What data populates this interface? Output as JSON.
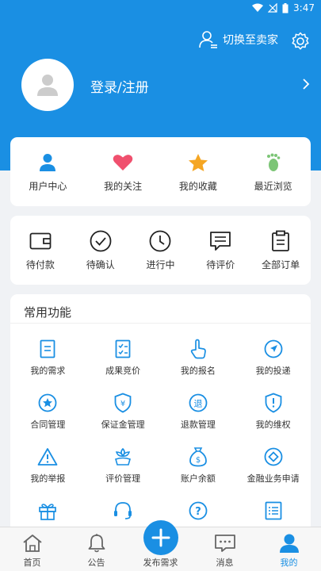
{
  "status_bar": {
    "time": "3:47"
  },
  "header": {
    "switch_label": "切换至卖家"
  },
  "profile": {
    "login_label": "登录/注册"
  },
  "quick_links": [
    {
      "label": "用户中心",
      "icon": "user-icon"
    },
    {
      "label": "我的关注",
      "icon": "heart-icon"
    },
    {
      "label": "我的收藏",
      "icon": "star-icon"
    },
    {
      "label": "最近浏览",
      "icon": "footprint-icon"
    }
  ],
  "orders": [
    {
      "label": "待付款",
      "icon": "wallet-icon"
    },
    {
      "label": "待确认",
      "icon": "check-circle-icon"
    },
    {
      "label": "进行中",
      "icon": "clock-icon"
    },
    {
      "label": "待评价",
      "icon": "comment-icon"
    },
    {
      "label": "全部订单",
      "icon": "clipboard-icon"
    }
  ],
  "functions": {
    "title": "常用功能",
    "items": [
      {
        "label": "我的需求",
        "icon": "document-icon"
      },
      {
        "label": "成果竞价",
        "icon": "checklist-icon"
      },
      {
        "label": "我的报名",
        "icon": "hand-pointer-icon"
      },
      {
        "label": "我的投递",
        "icon": "send-icon"
      },
      {
        "label": "合同管理",
        "icon": "contract-star-icon"
      },
      {
        "label": "保证金管理",
        "icon": "shield-yen-icon"
      },
      {
        "label": "退款管理",
        "icon": "refund-icon"
      },
      {
        "label": "我的维权",
        "icon": "shield-alert-icon"
      },
      {
        "label": "我的举报",
        "icon": "warning-icon"
      },
      {
        "label": "评价管理",
        "icon": "flower-icon"
      },
      {
        "label": "账户余额",
        "icon": "money-bag-icon"
      },
      {
        "label": "金融业务申请",
        "icon": "diamond-circle-icon"
      },
      {
        "label": "",
        "icon": "gift-icon"
      },
      {
        "label": "",
        "icon": "headset-icon"
      },
      {
        "label": "",
        "icon": "help-icon"
      },
      {
        "label": "",
        "icon": "list-icon"
      }
    ]
  },
  "tabbar": [
    {
      "label": "首页",
      "icon": "home-icon"
    },
    {
      "label": "公告",
      "icon": "bell-icon"
    },
    {
      "label": "发布需求",
      "icon": "plus-icon"
    },
    {
      "label": "消息",
      "icon": "message-icon"
    },
    {
      "label": "我的",
      "icon": "profile-icon"
    }
  ],
  "colors": {
    "primary": "#1a8fe3",
    "heart": "#f0506e",
    "star": "#f5a623",
    "foot": "#7cc576"
  }
}
